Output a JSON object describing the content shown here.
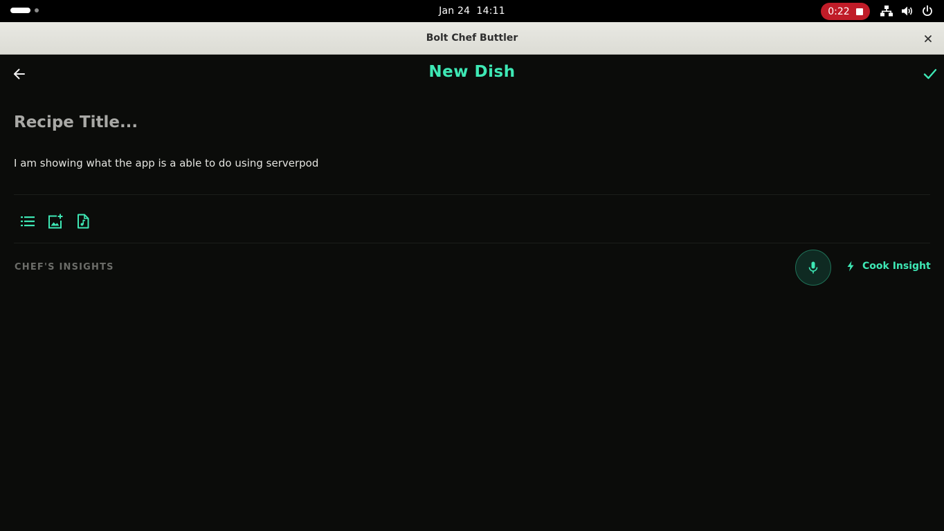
{
  "system_bar": {
    "clock": "Jan 24  14:11",
    "recording_time": "0:22",
    "icons": [
      "network-icon",
      "volume-icon",
      "power-icon"
    ]
  },
  "window": {
    "title": "Bolt Chef Buttler",
    "close_icon": "close-icon"
  },
  "header": {
    "back_icon": "arrow-left-icon",
    "title": "New Dish",
    "save_icon": "check-icon"
  },
  "editor": {
    "title_placeholder": "Recipe Title...",
    "body_text": "I am showing what the app is a able to do using serverpod"
  },
  "toolbar": {
    "tools": [
      "list-icon",
      "add-image-icon",
      "audio-file-icon"
    ]
  },
  "insights": {
    "section_label": "CHEF'S INSIGHTS",
    "mic_icon": "microphone-icon",
    "cook_insight_label": "Cook Insight",
    "cook_insight_icon": "bolt-icon"
  },
  "colors": {
    "accent": "#3ee8b5",
    "background": "#0b0c0a",
    "recording": "#c01c28",
    "titlebar": "#e3e3dc",
    "label_muted": "#6c6d69"
  }
}
